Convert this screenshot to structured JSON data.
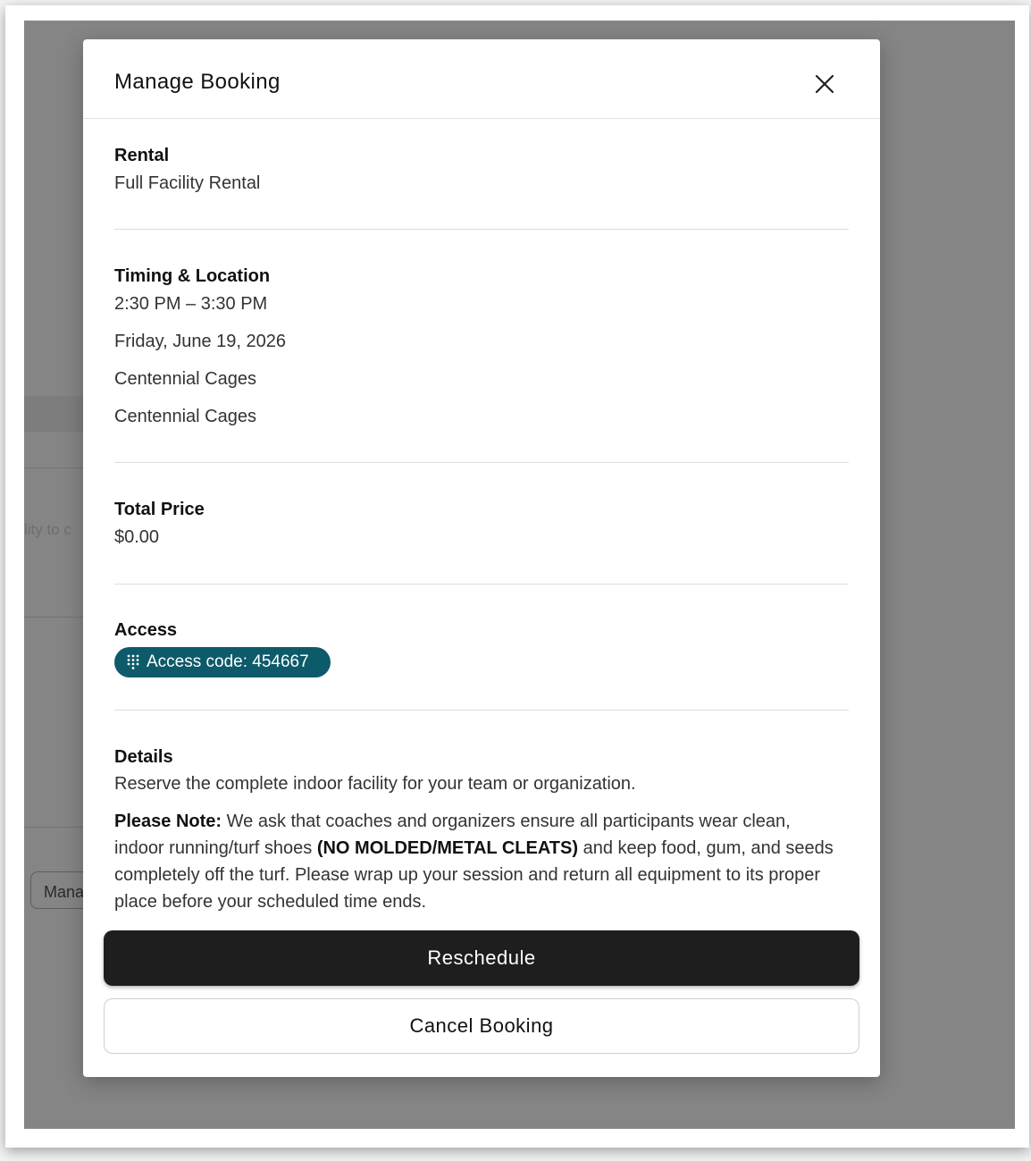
{
  "background": {
    "partial_text": "lity to c",
    "partial_button_label": "Mana"
  },
  "modal": {
    "title": "Manage Booking",
    "close_icon": "close-icon"
  },
  "rental": {
    "label": "Rental",
    "value": "Full Facility Rental"
  },
  "timing": {
    "label": "Timing & Location",
    "time": "2:30 PM – 3:30 PM",
    "date": "Friday, June 19, 2026",
    "location_1": "Centennial Cages",
    "location_2": "Centennial Cages"
  },
  "price": {
    "label": "Total Price",
    "value": "$0.00"
  },
  "access": {
    "label": "Access",
    "code_text": "Access code: 454667",
    "icon": "keypad-icon",
    "pill_color": "#0d5a6a"
  },
  "details": {
    "label": "Details",
    "description": "Reserve the complete indoor facility for your team or organization.",
    "note_prefix": "Please Note:",
    "note_part1": " We ask that coaches and organizers ensure all participants wear clean, indoor running/turf shoes ",
    "note_bold": "(NO MOLDED/METAL CLEATS)",
    "note_part2": " and keep food, gum, and seeds completely off the turf. Please wrap up your session and return all equipment to its proper place before your scheduled time ends."
  },
  "actions": {
    "reschedule_label": "Reschedule",
    "cancel_label": "Cancel Booking"
  }
}
